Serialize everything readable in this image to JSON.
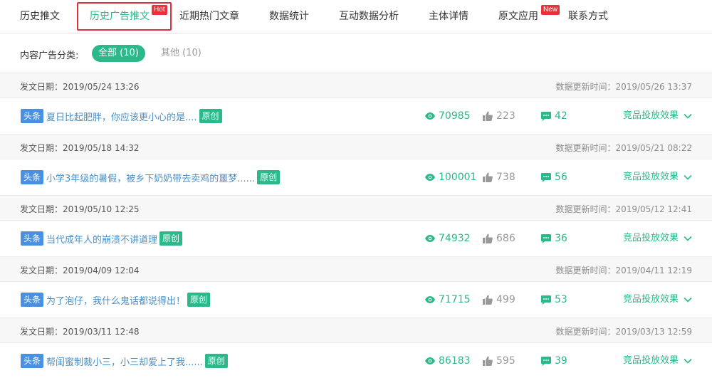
{
  "tabs": [
    {
      "label": "历史推文"
    },
    {
      "label": "历史广告推文"
    },
    {
      "label": "近期热门文章"
    },
    {
      "label": "数据统计"
    },
    {
      "label": "互动数据分析"
    },
    {
      "label": "主体详情"
    },
    {
      "label": "原文应用"
    },
    {
      "label": "联系方式"
    }
  ],
  "badges": {
    "hot": "Hot",
    "new": "New"
  },
  "filter": {
    "label": "内容广告分类:",
    "all": "全部 (10)",
    "other": "其他 (10)"
  },
  "labels": {
    "head_tag": "头条",
    "original_tag": "原创",
    "effect": "竞品投放效果"
  },
  "colors": {
    "accent": "#2bb88a",
    "link": "#4a90c8",
    "head_tag": "#4a90e2",
    "badge": "#e5323b"
  },
  "groups": [
    {
      "date": "发文日期：2019/05/24 13:26",
      "updated": "数据更新时间：2019/05/26 13:37",
      "title": "夏日比起肥胖，你应该更小心的是....",
      "reads": "70985",
      "likes": "223",
      "comments": "42"
    },
    {
      "date": "发文日期：2019/05/18 14:32",
      "updated": "数据更新时间：2019/05/21 08:22",
      "title": "小学3年级的暑假，被乡下奶奶带去卖鸡的噩梦......",
      "reads": "100001",
      "likes": "738",
      "comments": "56"
    },
    {
      "date": "发文日期：2019/05/10 12:25",
      "updated": "数据更新时间：2019/05/12 12:41",
      "title": "当代成年人的崩溃不讲道理",
      "reads": "74932",
      "likes": "686",
      "comments": "36"
    },
    {
      "date": "发文日期：2019/04/09 12:04",
      "updated": "数据更新时间：2019/04/11 12:19",
      "title": "为了泡仔，我什么鬼话都说得出！",
      "reads": "71715",
      "likes": "499",
      "comments": "53"
    },
    {
      "date": "发文日期：2019/03/11 12:48",
      "updated": "数据更新时间：2019/03/13 12:59",
      "title": "帮闺蜜制裁小三，小三却爱上了我......",
      "reads": "86183",
      "likes": "595",
      "comments": "39"
    }
  ]
}
